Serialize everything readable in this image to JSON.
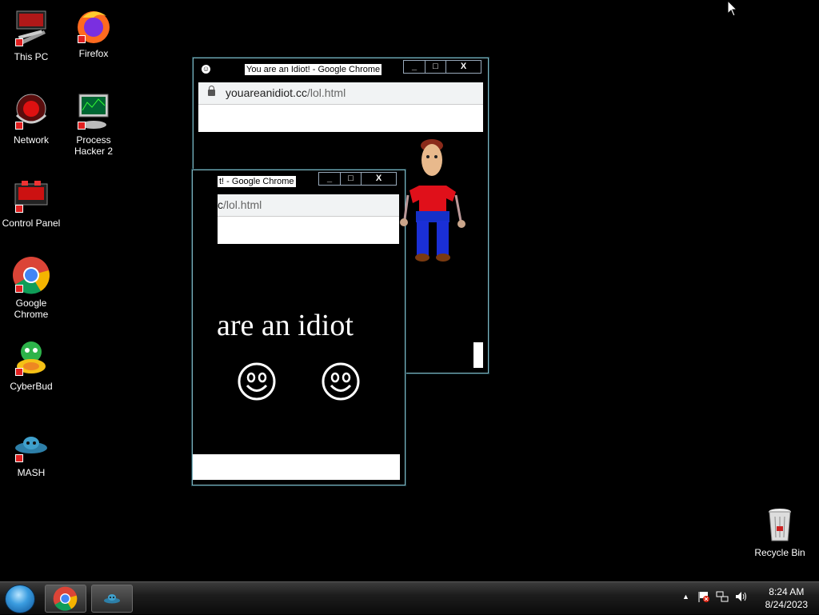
{
  "desktop": {
    "icons": [
      {
        "label": "This PC"
      },
      {
        "label": "Firefox"
      },
      {
        "label": "Network"
      },
      {
        "label": "Process Hacker 2"
      },
      {
        "label": "Control Panel"
      },
      {
        "label": "Google Chrome"
      },
      {
        "label": "CyberBud"
      },
      {
        "label": "MASH"
      },
      {
        "label": "Recycle Bin"
      }
    ]
  },
  "window_back": {
    "title": "You are an Idiot! - Google Chrome",
    "url_domain": "youareanidiot.cc",
    "url_path": "/lol.html",
    "controls": {
      "minimize": "_",
      "maximize": "□",
      "close": "X"
    }
  },
  "window_front": {
    "title": "t! - Google Chrome",
    "url_domain": "c",
    "url_path": "/lol.html",
    "message": "are an idiot",
    "controls": {
      "minimize": "_",
      "maximize": "□",
      "close": "X"
    }
  },
  "taskbar": {
    "clock_time": "8:24 AM",
    "clock_date": "8/24/2023",
    "tray_overflow": "▲"
  }
}
